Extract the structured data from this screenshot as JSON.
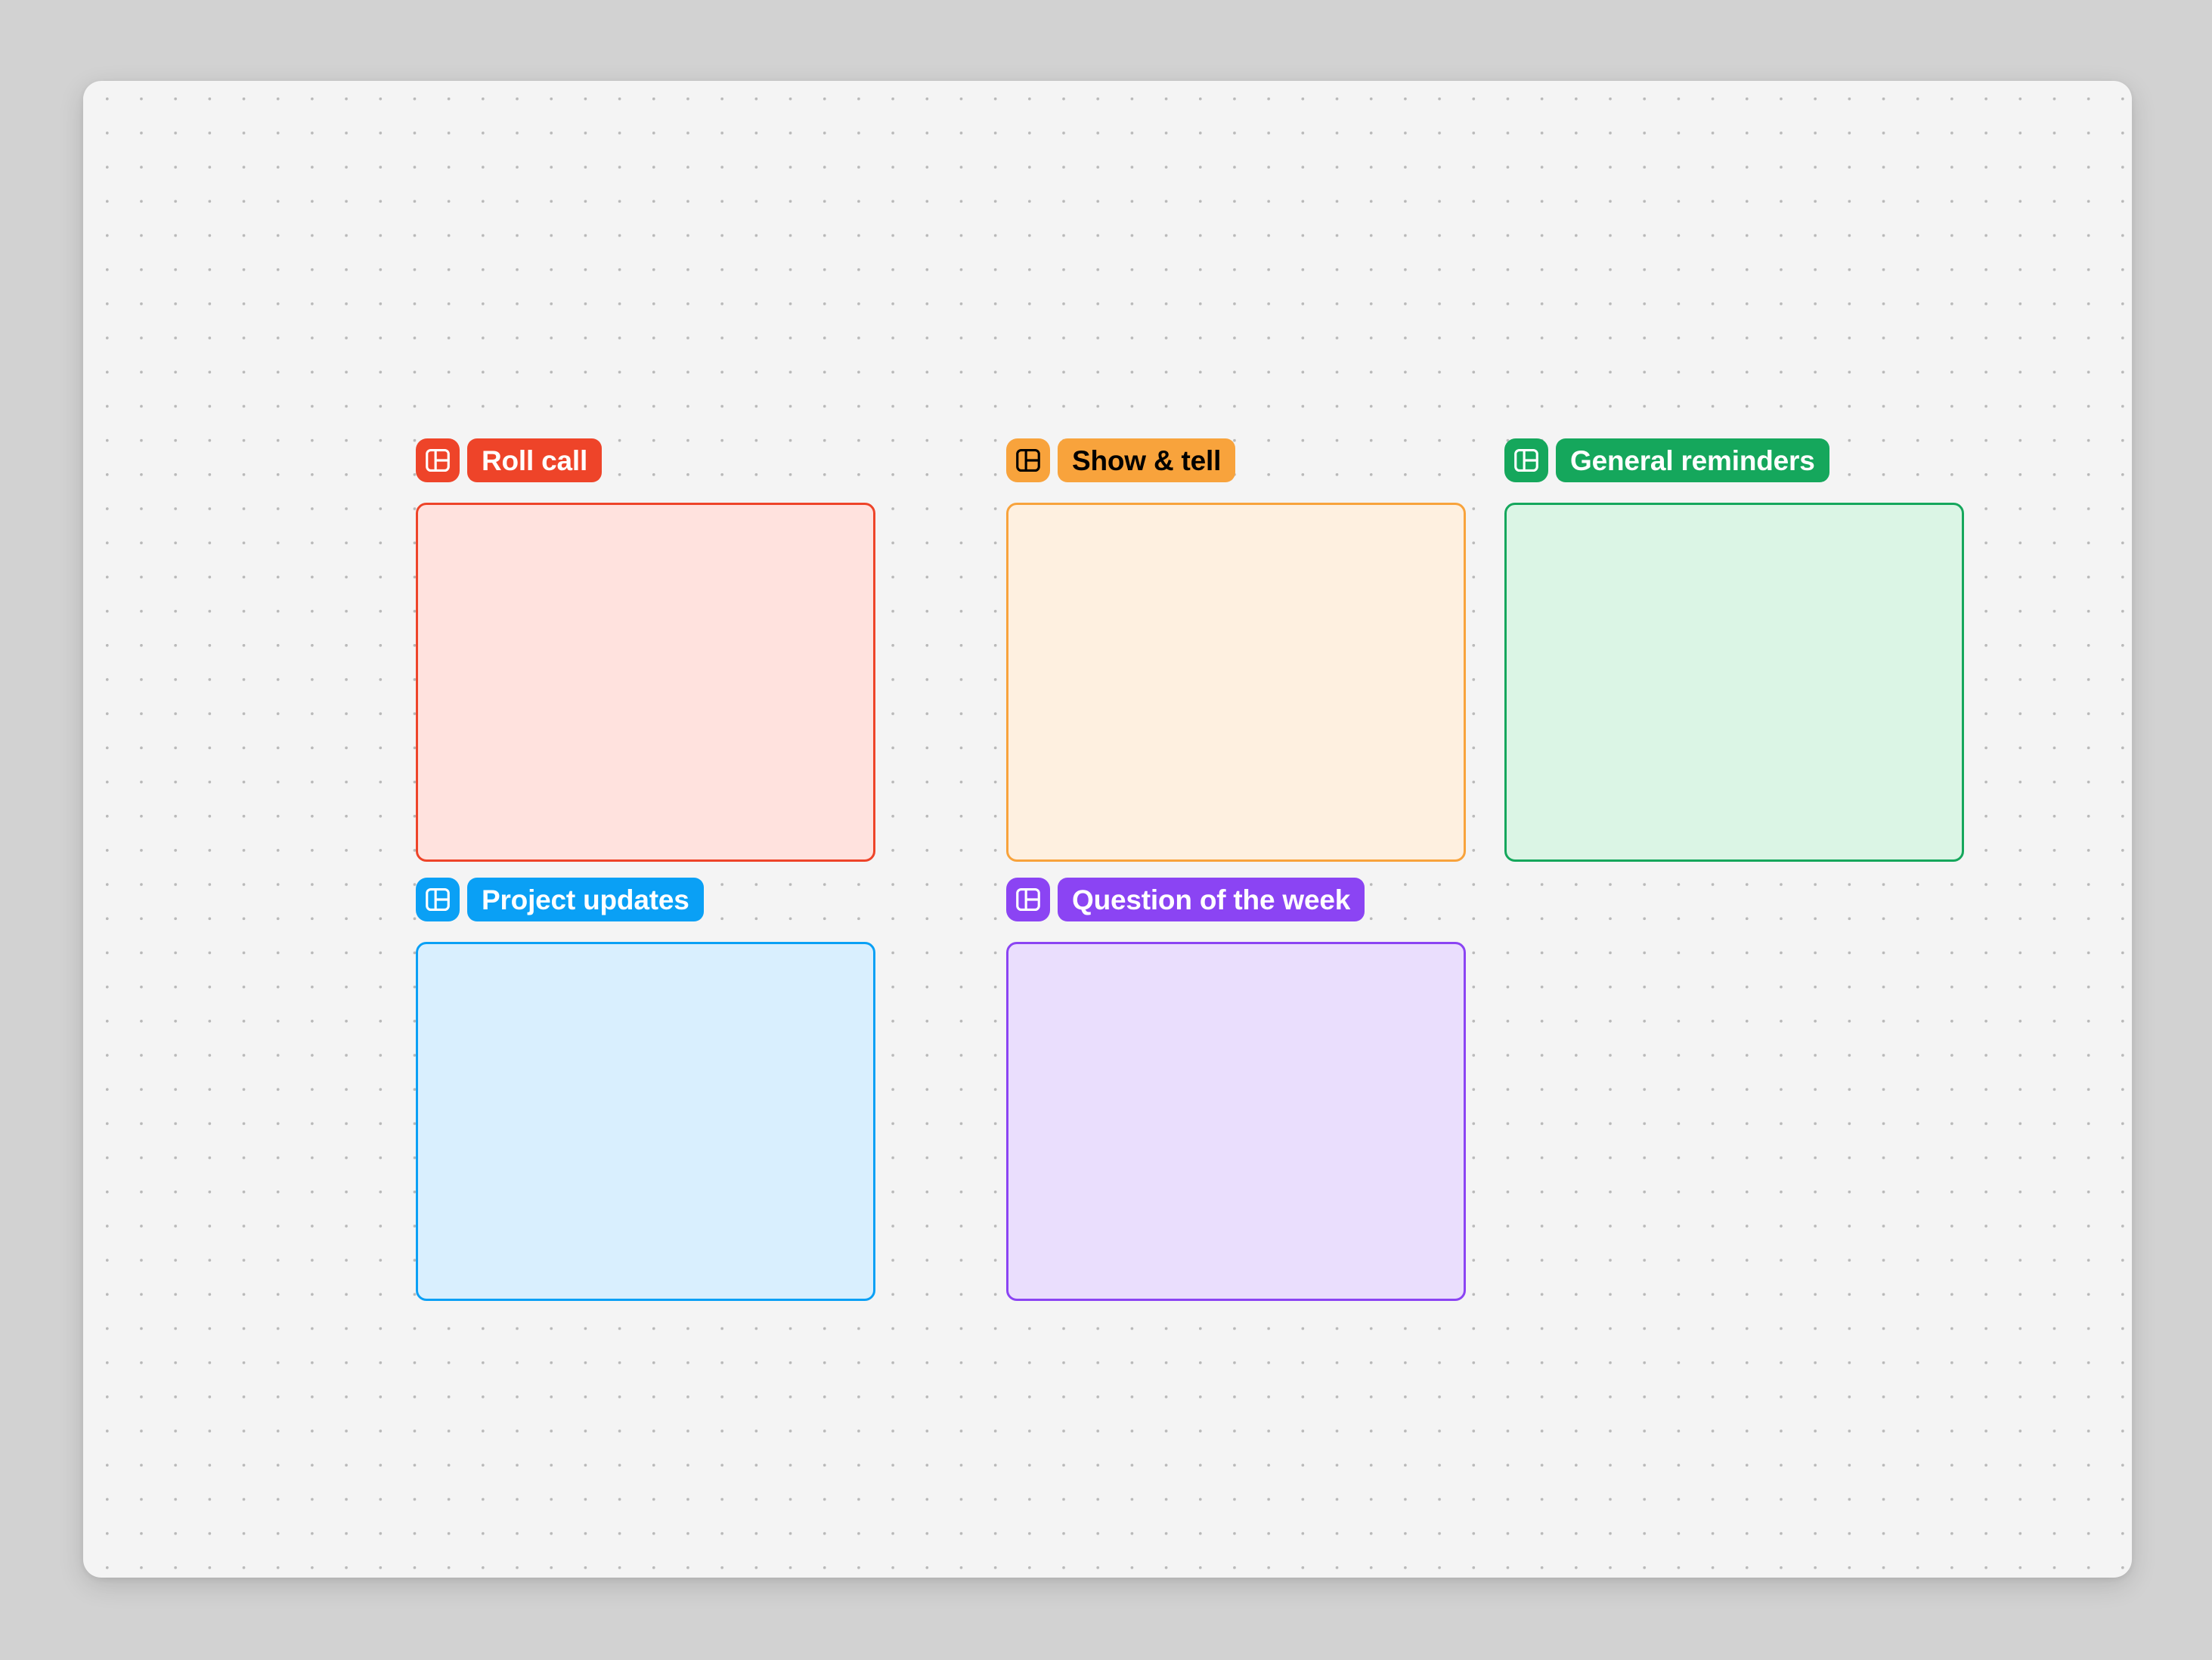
{
  "canvas": {
    "background_color": "#F4F4F4",
    "page_background_color": "#D2D2D2",
    "grid": "dot-grid"
  },
  "frames": [
    {
      "id": "roll-call",
      "label": "Roll call",
      "icon": "frame-layout-icon",
      "accent_color": "#EE4429",
      "fill_color": "#FFE2DE",
      "label_text_color": "#FFFFFF",
      "content": ""
    },
    {
      "id": "show-tell",
      "label": "Show & tell",
      "icon": "frame-layout-icon",
      "accent_color": "#F8A33C",
      "fill_color": "#FEF0E0",
      "label_text_color": "#000000",
      "content": ""
    },
    {
      "id": "general-reminders",
      "label": "General reminders",
      "icon": "frame-layout-icon",
      "accent_color": "#15A75C",
      "fill_color": "#DBF5E5",
      "label_text_color": "#FFFFFF",
      "content": ""
    },
    {
      "id": "project-updates",
      "label": "Project updates",
      "icon": "frame-layout-icon",
      "accent_color": "#0AA0F5",
      "fill_color": "#D9EFFE",
      "label_text_color": "#FFFFFF",
      "content": ""
    },
    {
      "id": "question-of-week",
      "label": "Question of the week",
      "icon": "frame-layout-icon",
      "accent_color": "#8B44F3",
      "fill_color": "#EADEFD",
      "label_text_color": "#FFFFFF",
      "content": ""
    }
  ]
}
